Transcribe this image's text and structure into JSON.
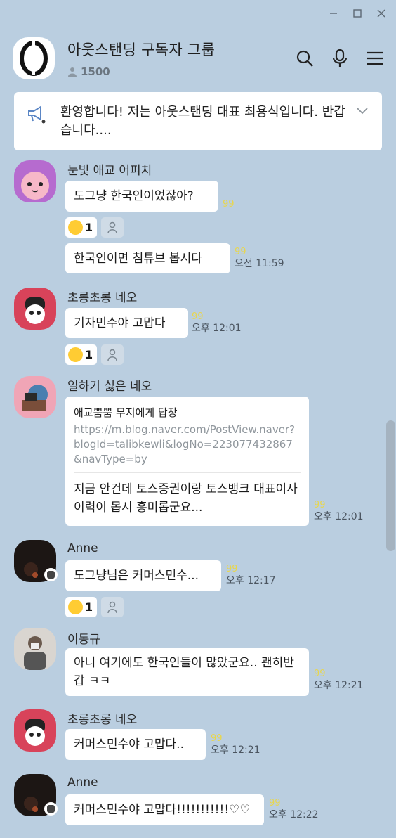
{
  "window": {},
  "room": {
    "title": "아웃스탠딩 구독자 그룹",
    "member_count": "1500"
  },
  "notice": {
    "text": "환영합니다! 저는 아웃스탠딩 대표 최용식입니다. 반갑습니다...."
  },
  "reaction_count": "1",
  "unread_mark": "99",
  "messages": [
    {
      "sender": "눈빛 애교 어피치",
      "text": "도그냥 한국인이었잖아?",
      "time": ""
    },
    {
      "sender": "",
      "text": "한국인이면 침튜브 봅시다",
      "time": "오전 11:59"
    },
    {
      "sender": "초롱초롱 네오",
      "text": "기자민수야 고맙다",
      "time": "오후 12:01"
    },
    {
      "sender": "일하기 싫은 네오",
      "reply_to": "애교뿜뿜 무지에게 답장",
      "reply_link": "https://m.blog.naver.com/PostView.naver?blogId=talibkewli&logNo=223077432867&navType=by",
      "text": "지금 안건데 토스증권이랑 토스뱅크 대표이사 이력이 몹시 흥미롭군요...",
      "time": "오후 12:01"
    },
    {
      "sender": "Anne",
      "text": "도그냥님은 커머스민수...",
      "time": "오후 12:17"
    },
    {
      "sender": "이동규",
      "text": "아니 여기에도 한국인들이 많았군요.. 괜히반갑 ㅋㅋ",
      "time": "오후 12:21"
    },
    {
      "sender": "초롱초롱 네오",
      "text": "커머스민수야 고맙다..",
      "time": "오후 12:21"
    },
    {
      "sender": "Anne",
      "text": "커머스민수야 고맙다!!!!!!!!!!!♡♡",
      "time": "오후 12:22"
    }
  ]
}
